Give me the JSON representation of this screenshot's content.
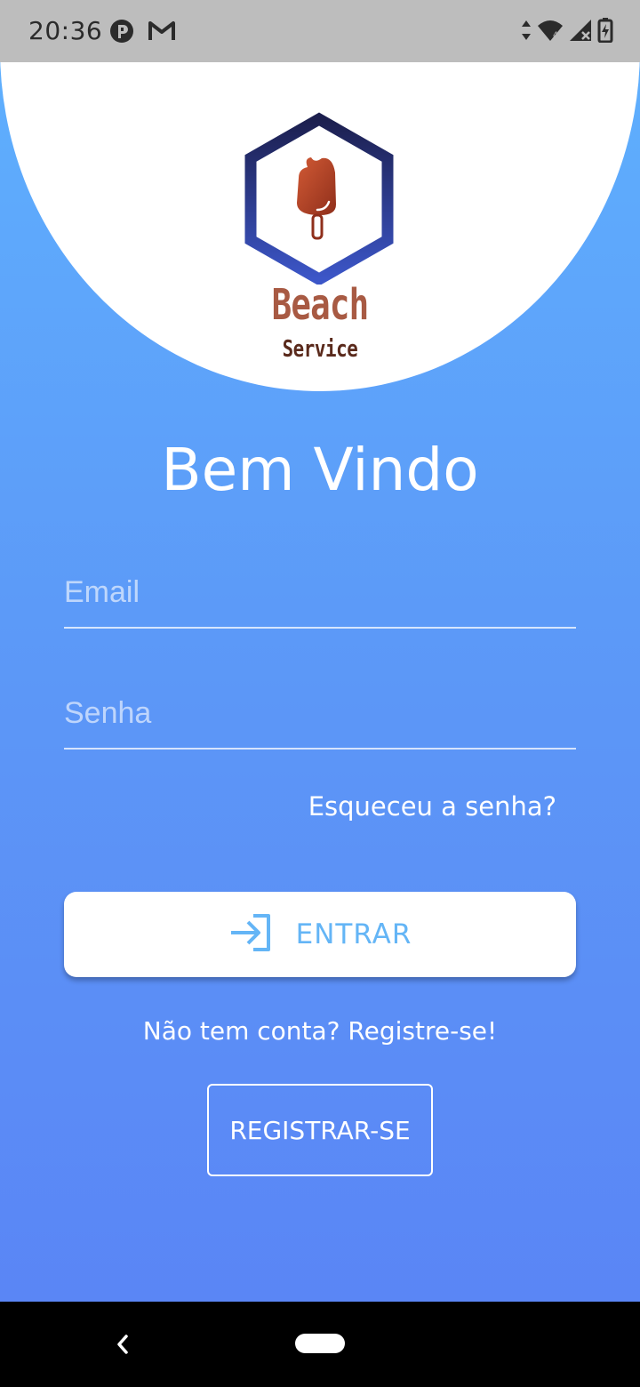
{
  "status_bar": {
    "time": "20:36",
    "left_icons": [
      "pocket-icon",
      "gmail-icon"
    ],
    "right_icons": [
      "data-arrows-icon",
      "wifi-icon",
      "signal-icon",
      "battery-icon"
    ]
  },
  "logo": {
    "line1": "Beach",
    "line2": "Service",
    "hexagon_color_top": "#1c1f4e",
    "hexagon_color_bottom": "#3c56c8",
    "popsicle_color": "#b8452a"
  },
  "welcome": {
    "title": "Bem Vindo"
  },
  "form": {
    "email": {
      "placeholder": "Email",
      "value": ""
    },
    "password": {
      "placeholder": "Senha",
      "value": ""
    },
    "forgot_password": "Esqueceu a senha?",
    "login_button": {
      "label": "ENTRAR",
      "icon": "login-arrow-icon"
    },
    "no_account_text": "Não tem conta? Registre-se!",
    "register_button": {
      "label": "REGISTRAR-SE"
    }
  },
  "nav_bar": {
    "back_icon": "back-chevron-icon",
    "home_icon": "home-pill-icon"
  },
  "colors": {
    "gradient_top": "#5fb1fe",
    "gradient_bottom": "#5a83f5",
    "accent": "#64b5f6",
    "status_bar_bg": "#bdbdbd"
  }
}
